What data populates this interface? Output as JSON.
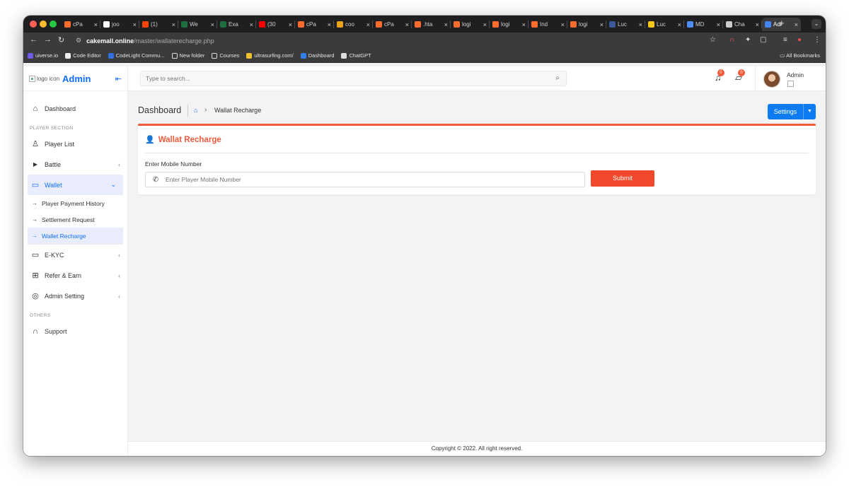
{
  "browser": {
    "tabs": [
      {
        "title": "cPa",
        "color": "#ff6c2c"
      },
      {
        "title": "joo",
        "color": "#ffffff"
      },
      {
        "title": "(1)",
        "color": "#ff4500"
      },
      {
        "title": "We",
        "color": "#1d6f42"
      },
      {
        "title": "Exa",
        "color": "#1d6f42"
      },
      {
        "title": "(30",
        "color": "#ff0000"
      },
      {
        "title": "cPa",
        "color": "#ff6c2c"
      },
      {
        "title": "coo",
        "color": "#e8a317"
      },
      {
        "title": "cPa",
        "color": "#ff6c2c"
      },
      {
        "title": ".hta",
        "color": "#ff6c2c"
      },
      {
        "title": "logi",
        "color": "#ff6c2c"
      },
      {
        "title": "logi",
        "color": "#ff6c2c"
      },
      {
        "title": "Ind",
        "color": "#ff6c2c"
      },
      {
        "title": "logi",
        "color": "#ff6c2c"
      },
      {
        "title": "Luc",
        "color": "#3b5998"
      },
      {
        "title": "Luc",
        "color": "#f5c518"
      },
      {
        "title": "MD",
        "color": "#4e8ef7"
      },
      {
        "title": "Cha",
        "color": "#cccccc"
      },
      {
        "title": "Adi",
        "color": "#4285f4"
      }
    ],
    "url_domain": "cakemall.online",
    "url_path": "/master/wallaterecharge.php",
    "bookmarks": [
      {
        "label": "uiverse.io",
        "color": "#6c5ce7"
      },
      {
        "label": "Code Editor",
        "color": "#eeeeee"
      },
      {
        "label": "CodeLight Commu...",
        "color": "#2f6fde"
      },
      {
        "label": "New folder",
        "color": "#3b3b3e"
      },
      {
        "label": "Courses",
        "color": "#3b3b3e"
      },
      {
        "label": "ultrasurfing.com/",
        "color": "#f0c030"
      },
      {
        "label": "Dashboard",
        "color": "#2f80ed"
      },
      {
        "label": "ChatGPT",
        "color": "#dddddd"
      }
    ],
    "all_bookmarks": "All Bookmarks"
  },
  "sidebar": {
    "logo_alt": "logo icon",
    "brand": "Admin",
    "dashboard": "Dashboard",
    "section_player": "PLAYER SECTION",
    "player_list": "Player List",
    "battle": "Battle",
    "wallet": "Wallet",
    "wallet_sub": [
      "Player Payment History",
      "Settlement Request",
      "Wallet Recharge"
    ],
    "ekyc": "E-KYC",
    "refer": "Refer & Earn",
    "admin_setting": "Admin Setting",
    "section_others": "OTHERS",
    "support": "Support"
  },
  "topbar": {
    "search_placeholder": "Type to search...",
    "notif_count": "0",
    "msg_count": "0",
    "admin_name": "Admin"
  },
  "page": {
    "title": "Dashboard",
    "breadcrumb_current": "Wallat Recharge",
    "settings_label": "Settings",
    "card_title": "Wallat Recharge",
    "field_label": "Enter Mobile Number",
    "field_placeholder": "Enter Player Mobile Number",
    "submit_label": "Submit"
  },
  "footer": "Copyright © 2022. All right reserved."
}
